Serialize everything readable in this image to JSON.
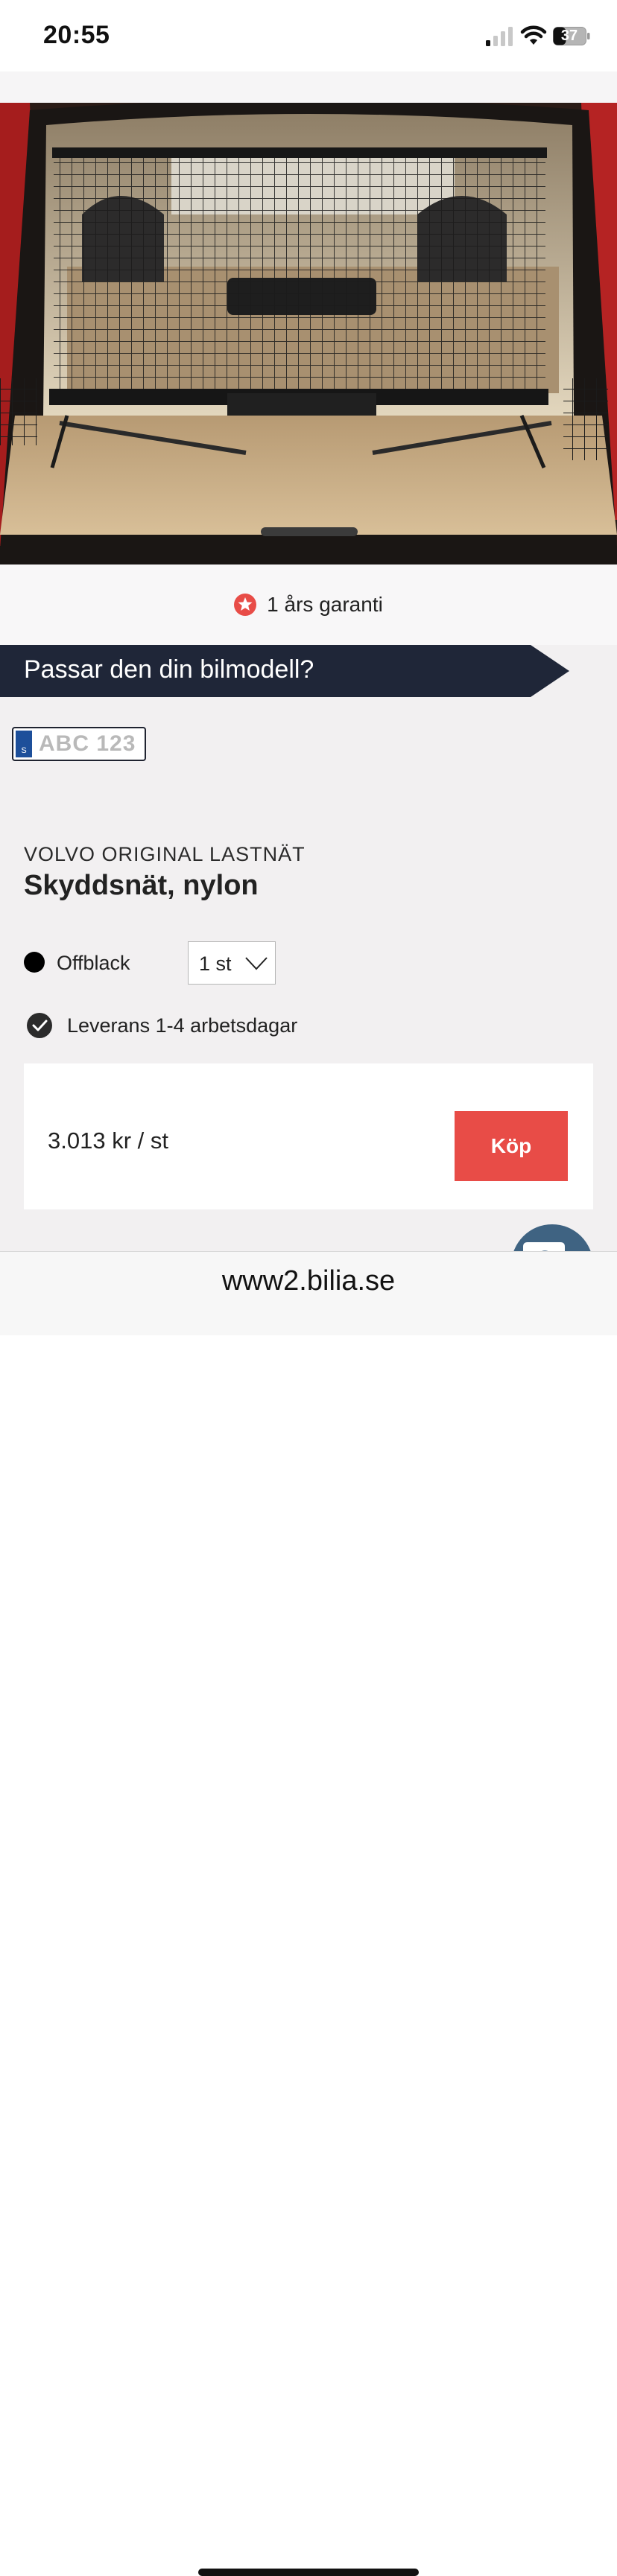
{
  "status_bar": {
    "time": "20:55",
    "battery": "37",
    "icons": [
      "signal-icon",
      "wifi-icon",
      "battery-icon"
    ]
  },
  "product": {
    "image_subject": "Car trunk with protective cargo net",
    "guarantee": "1 års garanti",
    "fit_banner": "Passar den din bilmodell?",
    "plate_placeholder": "ABC 123",
    "plate_country": "S",
    "brand_line": "VOLVO ORIGINAL LASTNÄT",
    "name": "Skyddsnät, nylon",
    "color": "Offblack",
    "quantity": "1 st",
    "delivery": "Leverans 1-4 arbetsdagar",
    "price": "3.013 kr / st",
    "buy_label": "Köp"
  },
  "browser": {
    "url": "www2.bilia.se"
  },
  "colors": {
    "accent_red": "#e84c47",
    "navy": "#1f2638",
    "chat_blue": "#3f6382",
    "page_bg": "#f2f0f1"
  }
}
